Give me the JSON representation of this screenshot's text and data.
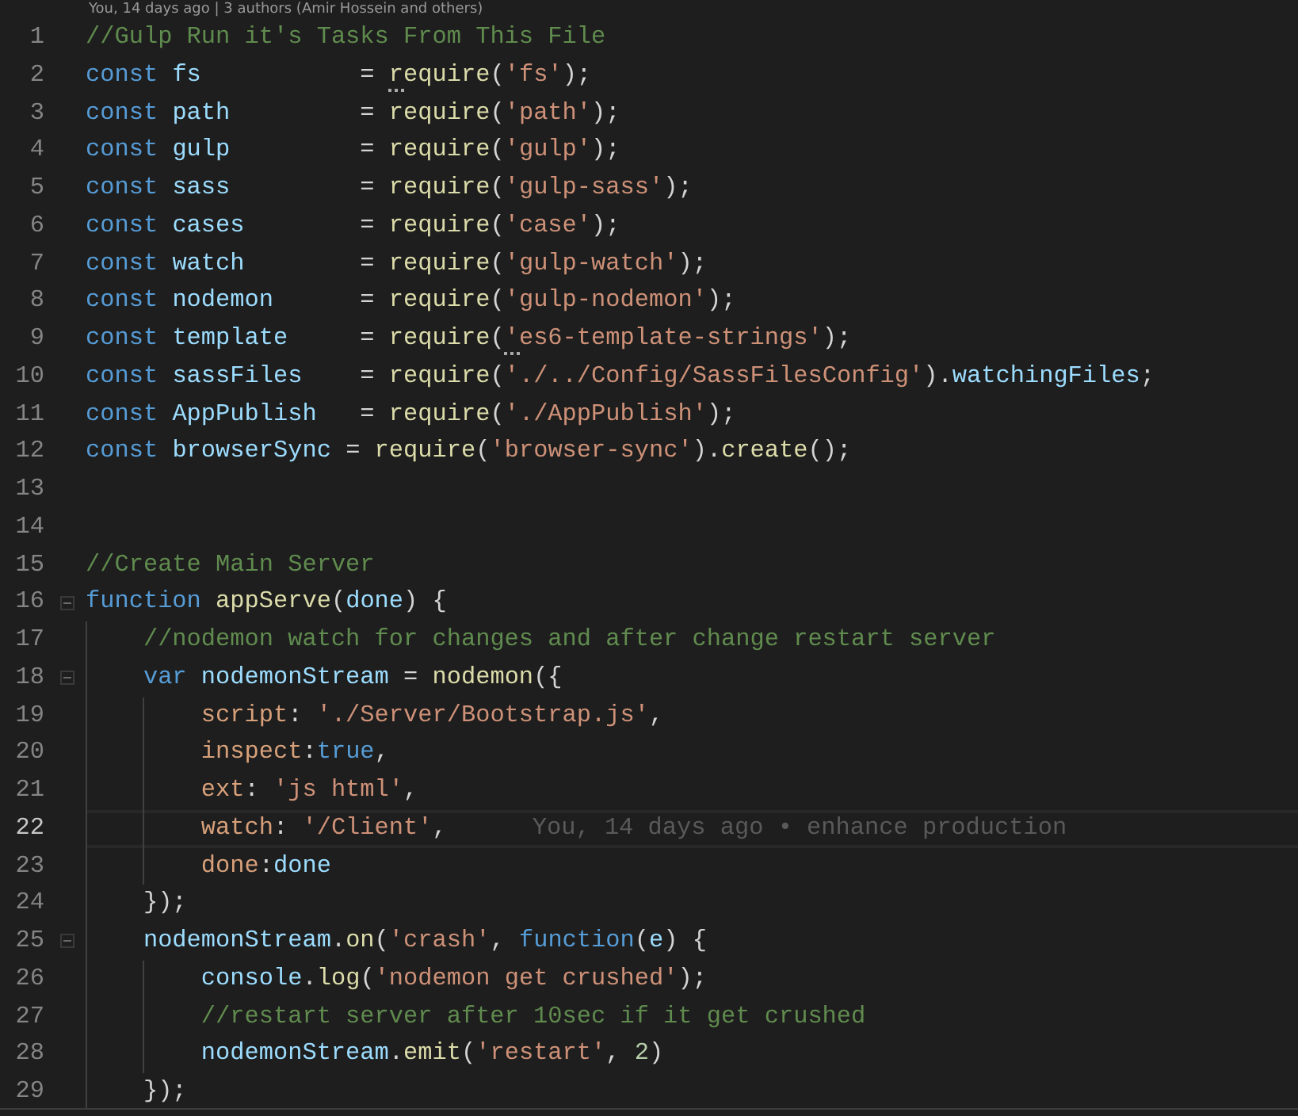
{
  "codelens": "You, 14 days ago | 3 authors (Amir Hossein and others)",
  "lines": [
    {
      "number": "1",
      "tokens": [
        {
          "kind": "comment",
          "text": "//Gulp Run it's Tasks From This File"
        }
      ]
    },
    {
      "number": "2",
      "tokens": [
        {
          "kind": "keyword",
          "text": "const "
        },
        {
          "kind": "variable",
          "text": "fs          "
        },
        {
          "kind": "plain",
          "text": " = "
        },
        {
          "kind": "function",
          "text": "require",
          "hint": true
        },
        {
          "kind": "plain",
          "text": "("
        },
        {
          "kind": "string",
          "text": "'fs'"
        },
        {
          "kind": "plain",
          "text": ");"
        }
      ]
    },
    {
      "number": "3",
      "tokens": [
        {
          "kind": "keyword",
          "text": "const "
        },
        {
          "kind": "variable",
          "text": "path        "
        },
        {
          "kind": "plain",
          "text": " = "
        },
        {
          "kind": "function",
          "text": "require"
        },
        {
          "kind": "plain",
          "text": "("
        },
        {
          "kind": "string",
          "text": "'path'"
        },
        {
          "kind": "plain",
          "text": ");"
        }
      ]
    },
    {
      "number": "4",
      "tokens": [
        {
          "kind": "keyword",
          "text": "const "
        },
        {
          "kind": "variable",
          "text": "gulp        "
        },
        {
          "kind": "plain",
          "text": " = "
        },
        {
          "kind": "function",
          "text": "require"
        },
        {
          "kind": "plain",
          "text": "("
        },
        {
          "kind": "string",
          "text": "'gulp'"
        },
        {
          "kind": "plain",
          "text": ");"
        }
      ]
    },
    {
      "number": "5",
      "tokens": [
        {
          "kind": "keyword",
          "text": "const "
        },
        {
          "kind": "variable",
          "text": "sass        "
        },
        {
          "kind": "plain",
          "text": " = "
        },
        {
          "kind": "function",
          "text": "require"
        },
        {
          "kind": "plain",
          "text": "("
        },
        {
          "kind": "string",
          "text": "'gulp-sass'"
        },
        {
          "kind": "plain",
          "text": ");"
        }
      ]
    },
    {
      "number": "6",
      "tokens": [
        {
          "kind": "keyword",
          "text": "const "
        },
        {
          "kind": "variable",
          "text": "cases       "
        },
        {
          "kind": "plain",
          "text": " = "
        },
        {
          "kind": "function",
          "text": "require"
        },
        {
          "kind": "plain",
          "text": "("
        },
        {
          "kind": "string",
          "text": "'case'"
        },
        {
          "kind": "plain",
          "text": ");"
        }
      ]
    },
    {
      "number": "7",
      "tokens": [
        {
          "kind": "keyword",
          "text": "const "
        },
        {
          "kind": "variable",
          "text": "watch       "
        },
        {
          "kind": "plain",
          "text": " = "
        },
        {
          "kind": "function",
          "text": "require"
        },
        {
          "kind": "plain",
          "text": "("
        },
        {
          "kind": "string",
          "text": "'gulp-watch'"
        },
        {
          "kind": "plain",
          "text": ");"
        }
      ]
    },
    {
      "number": "8",
      "tokens": [
        {
          "kind": "keyword",
          "text": "const "
        },
        {
          "kind": "variable",
          "text": "nodemon     "
        },
        {
          "kind": "plain",
          "text": " = "
        },
        {
          "kind": "function",
          "text": "require"
        },
        {
          "kind": "plain",
          "text": "("
        },
        {
          "kind": "string",
          "text": "'gulp-nodemon'"
        },
        {
          "kind": "plain",
          "text": ");"
        }
      ]
    },
    {
      "number": "9",
      "tokens": [
        {
          "kind": "keyword",
          "text": "const "
        },
        {
          "kind": "variable",
          "text": "template    "
        },
        {
          "kind": "plain",
          "text": " = "
        },
        {
          "kind": "function",
          "text": "require"
        },
        {
          "kind": "plain",
          "text": "("
        },
        {
          "kind": "string",
          "text": "'es6-template-strings'",
          "hint": true
        },
        {
          "kind": "plain",
          "text": ");"
        }
      ]
    },
    {
      "number": "10",
      "tokens": [
        {
          "kind": "keyword",
          "text": "const "
        },
        {
          "kind": "variable",
          "text": "sassFiles   "
        },
        {
          "kind": "plain",
          "text": " = "
        },
        {
          "kind": "function",
          "text": "require"
        },
        {
          "kind": "plain",
          "text": "("
        },
        {
          "kind": "string",
          "text": "'./../Config/SassFilesConfig'"
        },
        {
          "kind": "plain",
          "text": ")."
        },
        {
          "kind": "variable",
          "text": "watchingFiles"
        },
        {
          "kind": "plain",
          "text": ";"
        }
      ]
    },
    {
      "number": "11",
      "tokens": [
        {
          "kind": "keyword",
          "text": "const "
        },
        {
          "kind": "variable",
          "text": "AppPublish  "
        },
        {
          "kind": "plain",
          "text": " = "
        },
        {
          "kind": "function",
          "text": "require"
        },
        {
          "kind": "plain",
          "text": "("
        },
        {
          "kind": "string",
          "text": "'./AppPublish'"
        },
        {
          "kind": "plain",
          "text": ");"
        }
      ]
    },
    {
      "number": "12",
      "tokens": [
        {
          "kind": "keyword",
          "text": "const "
        },
        {
          "kind": "variable",
          "text": "browserSync"
        },
        {
          "kind": "plain",
          "text": " = "
        },
        {
          "kind": "function",
          "text": "require"
        },
        {
          "kind": "plain",
          "text": "("
        },
        {
          "kind": "string",
          "text": "'browser-sync'"
        },
        {
          "kind": "plain",
          "text": ")."
        },
        {
          "kind": "function",
          "text": "create"
        },
        {
          "kind": "plain",
          "text": "();"
        }
      ]
    },
    {
      "number": "13"
    },
    {
      "number": "14"
    },
    {
      "number": "15",
      "tokens": [
        {
          "kind": "comment",
          "text": "//Create Main Server"
        }
      ]
    },
    {
      "number": "16",
      "expanded": true,
      "tokens": [
        {
          "kind": "keyword",
          "text": "function "
        },
        {
          "kind": "function",
          "text": "appServe"
        },
        {
          "kind": "plain",
          "text": "("
        },
        {
          "kind": "variable",
          "text": "done"
        },
        {
          "kind": "plain",
          "text": ") {"
        }
      ]
    },
    {
      "number": "17",
      "tokens": [
        {
          "kind": "comment",
          "text": "    //nodemon watch for changes and after change restart server"
        }
      ]
    },
    {
      "number": "18",
      "expanded": true,
      "tokens": [
        {
          "kind": "keyword",
          "text": "    var "
        },
        {
          "kind": "variable",
          "text": "nodemonStream"
        },
        {
          "kind": "plain",
          "text": " = "
        },
        {
          "kind": "function",
          "text": "nodemon"
        },
        {
          "kind": "plain",
          "text": "({"
        }
      ]
    },
    {
      "number": "19",
      "tokens": [
        {
          "kind": "property",
          "text": "        script"
        },
        {
          "kind": "plain",
          "text": ": "
        },
        {
          "kind": "string",
          "text": "'./Server/Bootstrap.js'"
        },
        {
          "kind": "plain",
          "text": ","
        }
      ]
    },
    {
      "number": "20",
      "tokens": [
        {
          "kind": "property",
          "text": "        inspect"
        },
        {
          "kind": "plain",
          "text": ":"
        },
        {
          "kind": "keyword",
          "text": "true"
        },
        {
          "kind": "plain",
          "text": ","
        }
      ]
    },
    {
      "number": "21",
      "tokens": [
        {
          "kind": "property",
          "text": "        ext"
        },
        {
          "kind": "plain",
          "text": ": "
        },
        {
          "kind": "string",
          "text": "'js html'"
        },
        {
          "kind": "plain",
          "text": ","
        }
      ]
    },
    {
      "number": "22",
      "current": true,
      "blame": "You, 14 days ago • enhance production",
      "tokens": [
        {
          "kind": "property",
          "text": "        watch"
        },
        {
          "kind": "plain",
          "text": ": "
        },
        {
          "kind": "string",
          "text": "'/Client'"
        },
        {
          "kind": "plain",
          "text": ","
        }
      ]
    },
    {
      "number": "23",
      "tokens": [
        {
          "kind": "property",
          "text": "        done"
        },
        {
          "kind": "plain",
          "text": ":"
        },
        {
          "kind": "variable",
          "text": "done"
        }
      ]
    },
    {
      "number": "24",
      "tokens": [
        {
          "kind": "plain",
          "text": "    });"
        }
      ]
    },
    {
      "number": "25",
      "expanded": true,
      "tokens": [
        {
          "kind": "variable",
          "text": "    nodemonStream"
        },
        {
          "kind": "plain",
          "text": "."
        },
        {
          "kind": "function",
          "text": "on"
        },
        {
          "kind": "plain",
          "text": "("
        },
        {
          "kind": "string",
          "text": "'crash'"
        },
        {
          "kind": "plain",
          "text": ", "
        },
        {
          "kind": "keyword",
          "text": "function"
        },
        {
          "kind": "plain",
          "text": "("
        },
        {
          "kind": "variable",
          "text": "e"
        },
        {
          "kind": "plain",
          "text": ") {"
        }
      ]
    },
    {
      "number": "26",
      "tokens": [
        {
          "kind": "variable",
          "text": "        console"
        },
        {
          "kind": "plain",
          "text": "."
        },
        {
          "kind": "function",
          "text": "log"
        },
        {
          "kind": "plain",
          "text": "("
        },
        {
          "kind": "string",
          "text": "'nodemon get crushed'"
        },
        {
          "kind": "plain",
          "text": ");"
        }
      ]
    },
    {
      "number": "27",
      "tokens": [
        {
          "kind": "comment",
          "text": "        //restart server after 10sec if it get crushed"
        }
      ]
    },
    {
      "number": "28",
      "tokens": [
        {
          "kind": "variable",
          "text": "        nodemonStream"
        },
        {
          "kind": "plain",
          "text": "."
        },
        {
          "kind": "function",
          "text": "emit"
        },
        {
          "kind": "plain",
          "text": "("
        },
        {
          "kind": "string",
          "text": "'restart'"
        },
        {
          "kind": "plain",
          "text": ", "
        },
        {
          "kind": "number",
          "text": "2"
        },
        {
          "kind": "plain",
          "text": ")"
        }
      ]
    },
    {
      "number": "29",
      "tokens": [
        {
          "kind": "plain",
          "text": "    });"
        }
      ]
    }
  ]
}
